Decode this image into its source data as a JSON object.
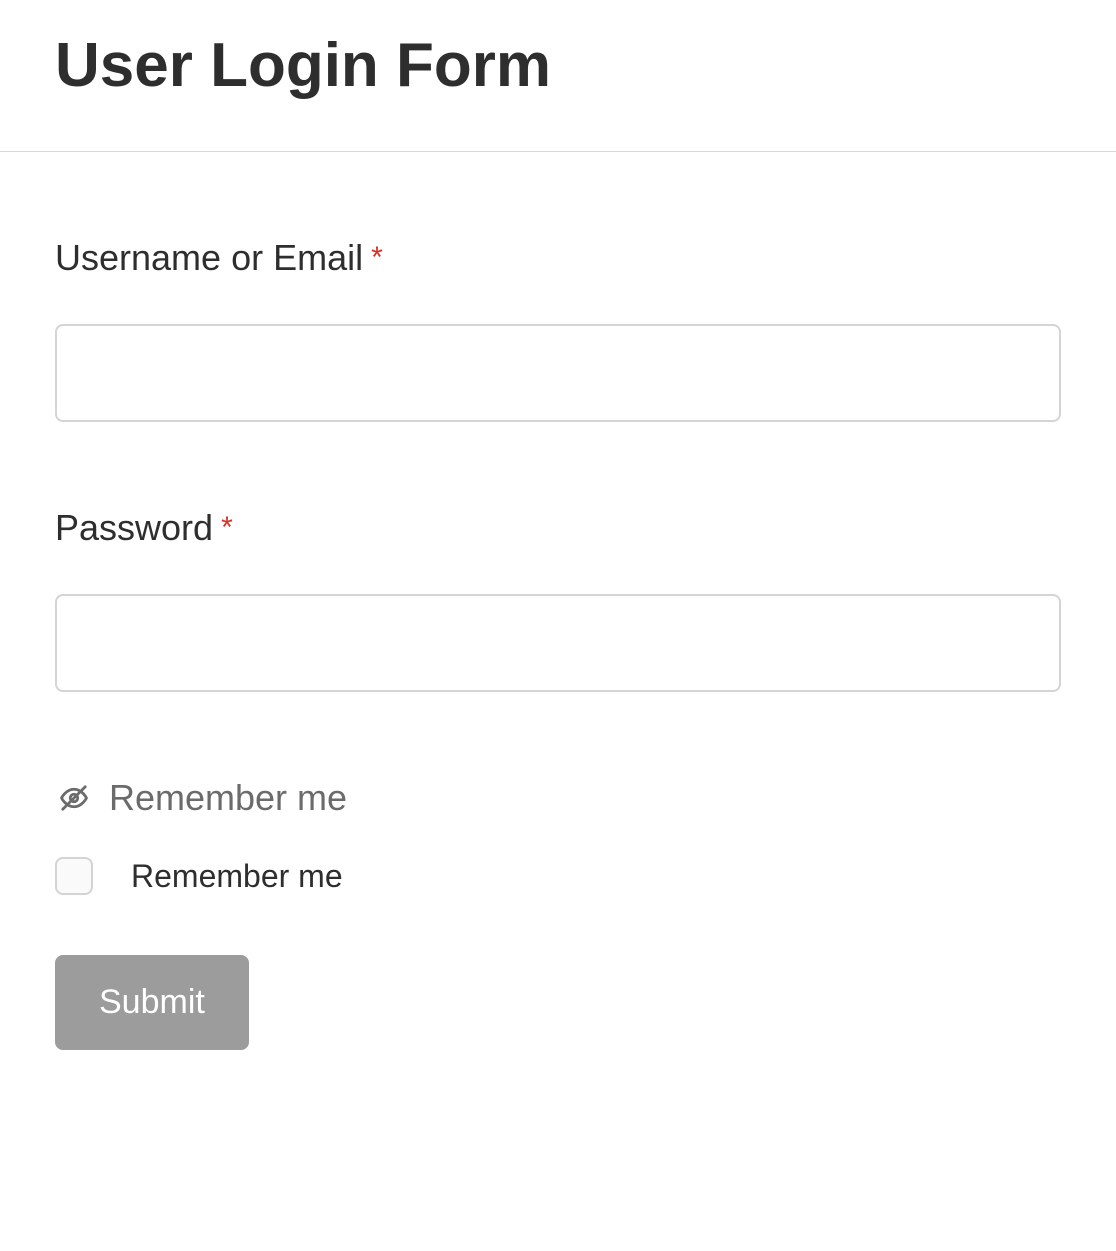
{
  "title": "User Login Form",
  "fields": {
    "username": {
      "label": "Username or Email",
      "required": "*",
      "value": ""
    },
    "password": {
      "label": "Password",
      "required": "*",
      "value": ""
    }
  },
  "remember": {
    "section_title": "Remember me",
    "checkbox_label": "Remember me"
  },
  "submit_label": "Submit"
}
